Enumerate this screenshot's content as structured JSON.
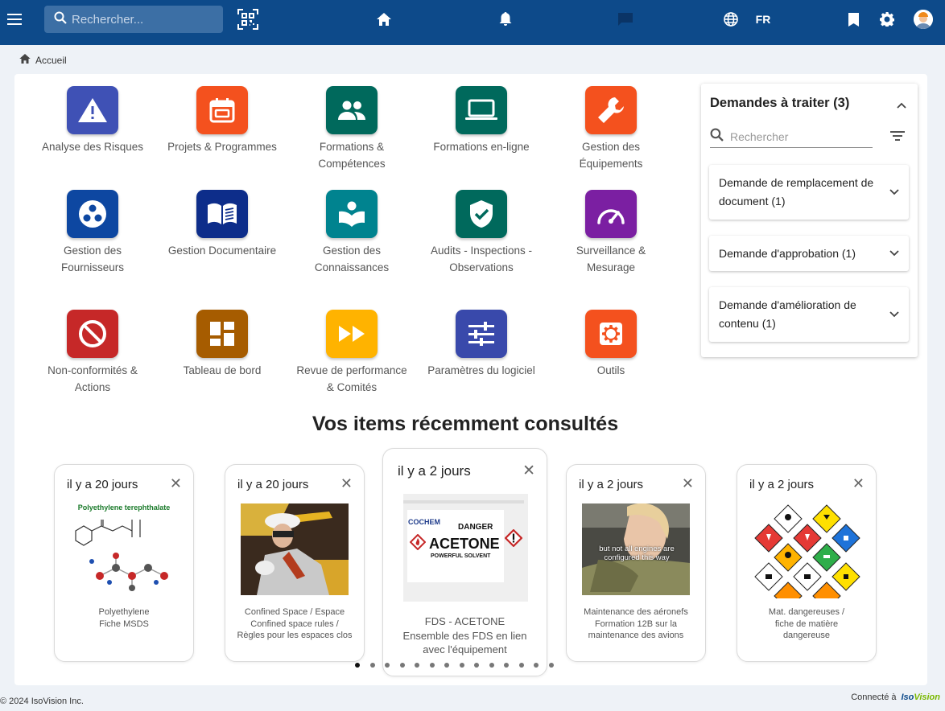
{
  "topbar": {
    "search_placeholder": "Rechercher...",
    "language": "FR"
  },
  "breadcrumb": {
    "home": "Accueil"
  },
  "tiles": [
    {
      "label": "Analyse des Risques",
      "color": "#3f51b5",
      "icon": "warning-icon"
    },
    {
      "label": "Projets & Programmes",
      "color": "#f4511e",
      "icon": "calendar-icon"
    },
    {
      "label": "Formations & Compétences",
      "color": "#00695c",
      "icon": "people-icon"
    },
    {
      "label": "Formations en-ligne",
      "color": "#00695c",
      "icon": "laptop-icon"
    },
    {
      "label": "Gestion des Équipements",
      "color": "#f4511e",
      "icon": "wrench-icon"
    },
    {
      "label": "Gestion des Fournisseurs",
      "color": "#0d47a1",
      "icon": "dots-circle-icon"
    },
    {
      "label": "Gestion Documentaire",
      "color": "#0d2d8a",
      "icon": "book-icon"
    },
    {
      "label": "Gestion des Connaissances",
      "color": "#00838f",
      "icon": "reader-icon"
    },
    {
      "label": "Audits - Inspections - Observations",
      "color": "#00695c",
      "icon": "shield-check-icon"
    },
    {
      "label": "Surveillance & Mesurage",
      "color": "#7b1fa2",
      "icon": "gauge-icon"
    },
    {
      "label": "Non-conformités & Actions",
      "color": "#c62828",
      "icon": "block-icon"
    },
    {
      "label": "Tableau de bord",
      "color": "#a65c00",
      "icon": "dashboard-icon"
    },
    {
      "label": "Revue de performance & Comités",
      "color": "#ffb300",
      "icon": "fast-forward-icon"
    },
    {
      "label": "Paramètres du logiciel",
      "color": "#3949ab",
      "icon": "sliders-icon"
    },
    {
      "label": "Outils",
      "color": "#f4511e",
      "icon": "gear-icon"
    }
  ],
  "requests": {
    "title": "Demandes à traiter (3)",
    "search_placeholder": "Rechercher",
    "items": [
      {
        "label": "Demande de remplacement de document (1)"
      },
      {
        "label": "Demande d'approbation (1)"
      },
      {
        "label": "Demande d'amélioration de contenu (1)"
      }
    ]
  },
  "recent": {
    "title": "Vos items récemment consultés",
    "cards": [
      {
        "when": "il y a 20 jours",
        "line1": "Polyethylene",
        "line2": "Fiche MSDS",
        "line3": "",
        "image_caption": "Polyethylene terephthalate"
      },
      {
        "when": "il y a 20 jours",
        "line1": "Confined Space / Espace",
        "line2": "Confined space rules /",
        "line3": "Règles pour les espaces clos"
      },
      {
        "when": "il y a 2 jours",
        "line1": "FDS - ACETONE",
        "line2": "Ensemble des FDS en lien",
        "line3": "avec l'équipement",
        "image_text": {
          "brand": "COCHEM",
          "danger": "DANGER",
          "product": "ACETONE",
          "sub": "POWERFUL SOLVENT"
        }
      },
      {
        "when": "il y a 2 jours",
        "line1": "Maintenance des aéronefs",
        "line2": "Formation 12B sur la",
        "line3": "maintenance des avions",
        "image_text": "but not all engines are configured this way"
      },
      {
        "when": "il y a 2 jours",
        "line1": "Mat. dangereuses /",
        "line2": "fiche de matière",
        "line3": "dangereuse"
      }
    ]
  },
  "footer": {
    "copyright": "© 2024 IsoVision Inc.",
    "connected": "Connecté à",
    "brand_a": "Iso",
    "brand_b": "Vision"
  }
}
